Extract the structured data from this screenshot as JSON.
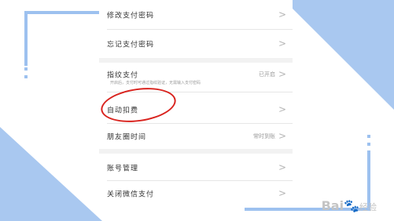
{
  "settings": {
    "rows": [
      {
        "label": "修改支付密码",
        "value": ""
      },
      {
        "label": "忘记支付密码",
        "value": ""
      },
      {
        "label": "指纹支付",
        "value": "已开启"
      },
      {
        "label": "自动扣费",
        "value": ""
      },
      {
        "label": "朋友圈时间",
        "value": "常时到账"
      },
      {
        "label": "账号管理",
        "value": ""
      },
      {
        "label": "关闭微信支付",
        "value": ""
      }
    ],
    "fingerprint_subtitle": "开启后，支付时可通过指纹验证，无需输入支付密码",
    "chevron": ">"
  },
  "annotation": {
    "highlight_color": "#d9231e"
  },
  "watermark": {
    "text": "Bai",
    "suffix": "经验"
  },
  "colors": {
    "frame": "#9dc1ef",
    "accent": "#a9c8f0"
  }
}
